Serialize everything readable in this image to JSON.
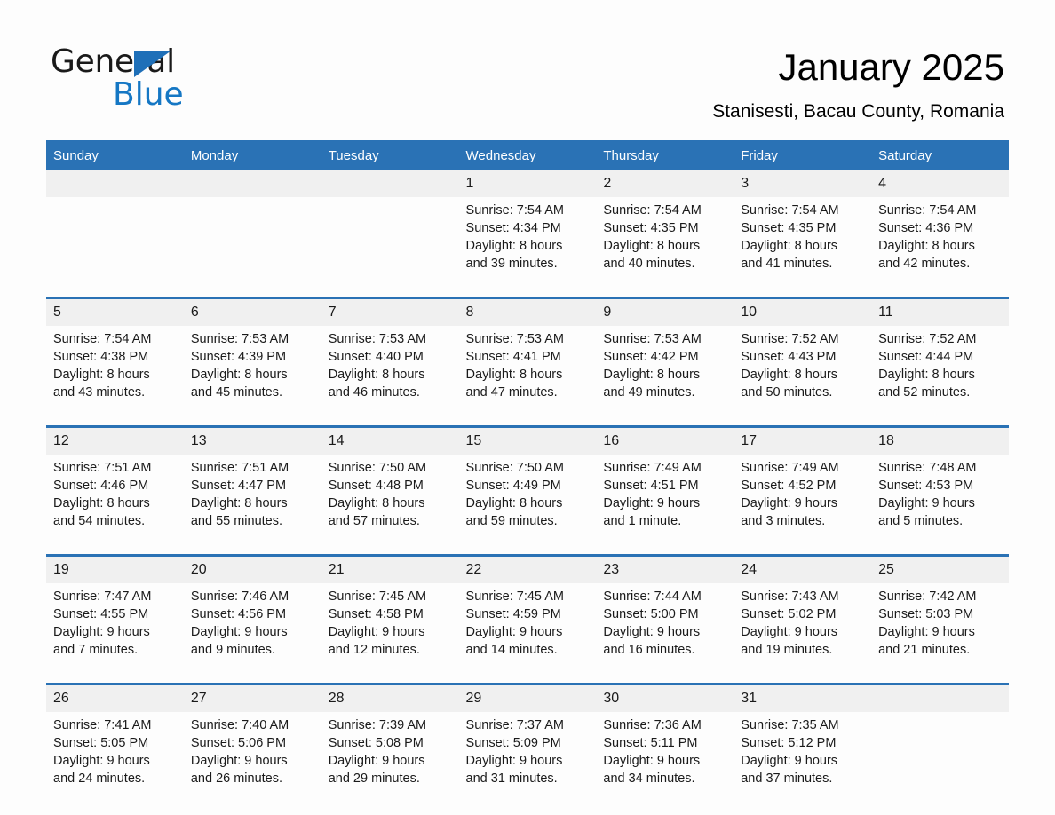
{
  "brand": {
    "name_part1": "General",
    "name_part2": "Blue",
    "triangle_color": "#1e6fb8",
    "blue_color": "#1577c4"
  },
  "header": {
    "title": "January 2025",
    "subtitle": "Stanisesti, Bacau County, Romania"
  },
  "theme": {
    "header_blue": "#2a72b5",
    "daynum_gray": "#f0f0f0",
    "page_background": "#fdfdfd"
  },
  "weekday_headers": [
    "Sunday",
    "Monday",
    "Tuesday",
    "Wednesday",
    "Thursday",
    "Friday",
    "Saturday"
  ],
  "weeks": [
    [
      {
        "day": "",
        "sunrise": "",
        "sunset": "",
        "daylight1": "",
        "daylight2": ""
      },
      {
        "day": "",
        "sunrise": "",
        "sunset": "",
        "daylight1": "",
        "daylight2": ""
      },
      {
        "day": "",
        "sunrise": "",
        "sunset": "",
        "daylight1": "",
        "daylight2": ""
      },
      {
        "day": "1",
        "sunrise": "Sunrise: 7:54 AM",
        "sunset": "Sunset: 4:34 PM",
        "daylight1": "Daylight: 8 hours",
        "daylight2": "and 39 minutes."
      },
      {
        "day": "2",
        "sunrise": "Sunrise: 7:54 AM",
        "sunset": "Sunset: 4:35 PM",
        "daylight1": "Daylight: 8 hours",
        "daylight2": "and 40 minutes."
      },
      {
        "day": "3",
        "sunrise": "Sunrise: 7:54 AM",
        "sunset": "Sunset: 4:35 PM",
        "daylight1": "Daylight: 8 hours",
        "daylight2": "and 41 minutes."
      },
      {
        "day": "4",
        "sunrise": "Sunrise: 7:54 AM",
        "sunset": "Sunset: 4:36 PM",
        "daylight1": "Daylight: 8 hours",
        "daylight2": "and 42 minutes."
      }
    ],
    [
      {
        "day": "5",
        "sunrise": "Sunrise: 7:54 AM",
        "sunset": "Sunset: 4:38 PM",
        "daylight1": "Daylight: 8 hours",
        "daylight2": "and 43 minutes."
      },
      {
        "day": "6",
        "sunrise": "Sunrise: 7:53 AM",
        "sunset": "Sunset: 4:39 PM",
        "daylight1": "Daylight: 8 hours",
        "daylight2": "and 45 minutes."
      },
      {
        "day": "7",
        "sunrise": "Sunrise: 7:53 AM",
        "sunset": "Sunset: 4:40 PM",
        "daylight1": "Daylight: 8 hours",
        "daylight2": "and 46 minutes."
      },
      {
        "day": "8",
        "sunrise": "Sunrise: 7:53 AM",
        "sunset": "Sunset: 4:41 PM",
        "daylight1": "Daylight: 8 hours",
        "daylight2": "and 47 minutes."
      },
      {
        "day": "9",
        "sunrise": "Sunrise: 7:53 AM",
        "sunset": "Sunset: 4:42 PM",
        "daylight1": "Daylight: 8 hours",
        "daylight2": "and 49 minutes."
      },
      {
        "day": "10",
        "sunrise": "Sunrise: 7:52 AM",
        "sunset": "Sunset: 4:43 PM",
        "daylight1": "Daylight: 8 hours",
        "daylight2": "and 50 minutes."
      },
      {
        "day": "11",
        "sunrise": "Sunrise: 7:52 AM",
        "sunset": "Sunset: 4:44 PM",
        "daylight1": "Daylight: 8 hours",
        "daylight2": "and 52 minutes."
      }
    ],
    [
      {
        "day": "12",
        "sunrise": "Sunrise: 7:51 AM",
        "sunset": "Sunset: 4:46 PM",
        "daylight1": "Daylight: 8 hours",
        "daylight2": "and 54 minutes."
      },
      {
        "day": "13",
        "sunrise": "Sunrise: 7:51 AM",
        "sunset": "Sunset: 4:47 PM",
        "daylight1": "Daylight: 8 hours",
        "daylight2": "and 55 minutes."
      },
      {
        "day": "14",
        "sunrise": "Sunrise: 7:50 AM",
        "sunset": "Sunset: 4:48 PM",
        "daylight1": "Daylight: 8 hours",
        "daylight2": "and 57 minutes."
      },
      {
        "day": "15",
        "sunrise": "Sunrise: 7:50 AM",
        "sunset": "Sunset: 4:49 PM",
        "daylight1": "Daylight: 8 hours",
        "daylight2": "and 59 minutes."
      },
      {
        "day": "16",
        "sunrise": "Sunrise: 7:49 AM",
        "sunset": "Sunset: 4:51 PM",
        "daylight1": "Daylight: 9 hours",
        "daylight2": "and 1 minute."
      },
      {
        "day": "17",
        "sunrise": "Sunrise: 7:49 AM",
        "sunset": "Sunset: 4:52 PM",
        "daylight1": "Daylight: 9 hours",
        "daylight2": "and 3 minutes."
      },
      {
        "day": "18",
        "sunrise": "Sunrise: 7:48 AM",
        "sunset": "Sunset: 4:53 PM",
        "daylight1": "Daylight: 9 hours",
        "daylight2": "and 5 minutes."
      }
    ],
    [
      {
        "day": "19",
        "sunrise": "Sunrise: 7:47 AM",
        "sunset": "Sunset: 4:55 PM",
        "daylight1": "Daylight: 9 hours",
        "daylight2": "and 7 minutes."
      },
      {
        "day": "20",
        "sunrise": "Sunrise: 7:46 AM",
        "sunset": "Sunset: 4:56 PM",
        "daylight1": "Daylight: 9 hours",
        "daylight2": "and 9 minutes."
      },
      {
        "day": "21",
        "sunrise": "Sunrise: 7:45 AM",
        "sunset": "Sunset: 4:58 PM",
        "daylight1": "Daylight: 9 hours",
        "daylight2": "and 12 minutes."
      },
      {
        "day": "22",
        "sunrise": "Sunrise: 7:45 AM",
        "sunset": "Sunset: 4:59 PM",
        "daylight1": "Daylight: 9 hours",
        "daylight2": "and 14 minutes."
      },
      {
        "day": "23",
        "sunrise": "Sunrise: 7:44 AM",
        "sunset": "Sunset: 5:00 PM",
        "daylight1": "Daylight: 9 hours",
        "daylight2": "and 16 minutes."
      },
      {
        "day": "24",
        "sunrise": "Sunrise: 7:43 AM",
        "sunset": "Sunset: 5:02 PM",
        "daylight1": "Daylight: 9 hours",
        "daylight2": "and 19 minutes."
      },
      {
        "day": "25",
        "sunrise": "Sunrise: 7:42 AM",
        "sunset": "Sunset: 5:03 PM",
        "daylight1": "Daylight: 9 hours",
        "daylight2": "and 21 minutes."
      }
    ],
    [
      {
        "day": "26",
        "sunrise": "Sunrise: 7:41 AM",
        "sunset": "Sunset: 5:05 PM",
        "daylight1": "Daylight: 9 hours",
        "daylight2": "and 24 minutes."
      },
      {
        "day": "27",
        "sunrise": "Sunrise: 7:40 AM",
        "sunset": "Sunset: 5:06 PM",
        "daylight1": "Daylight: 9 hours",
        "daylight2": "and 26 minutes."
      },
      {
        "day": "28",
        "sunrise": "Sunrise: 7:39 AM",
        "sunset": "Sunset: 5:08 PM",
        "daylight1": "Daylight: 9 hours",
        "daylight2": "and 29 minutes."
      },
      {
        "day": "29",
        "sunrise": "Sunrise: 7:37 AM",
        "sunset": "Sunset: 5:09 PM",
        "daylight1": "Daylight: 9 hours",
        "daylight2": "and 31 minutes."
      },
      {
        "day": "30",
        "sunrise": "Sunrise: 7:36 AM",
        "sunset": "Sunset: 5:11 PM",
        "daylight1": "Daylight: 9 hours",
        "daylight2": "and 34 minutes."
      },
      {
        "day": "31",
        "sunrise": "Sunrise: 7:35 AM",
        "sunset": "Sunset: 5:12 PM",
        "daylight1": "Daylight: 9 hours",
        "daylight2": "and 37 minutes."
      },
      {
        "day": "",
        "sunrise": "",
        "sunset": "",
        "daylight1": "",
        "daylight2": ""
      }
    ]
  ]
}
